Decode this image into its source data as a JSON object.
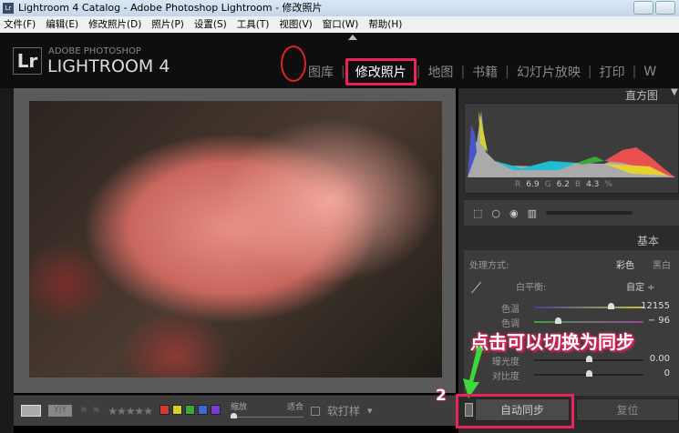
{
  "window": {
    "title": "Lightroom 4 Catalog - Adobe Photoshop Lightroom - 修改照片",
    "icon": "Lr"
  },
  "menu": [
    "文件(F)",
    "编辑(E)",
    "修改照片(D)",
    "照片(P)",
    "设置(S)",
    "工具(T)",
    "视图(V)",
    "窗口(W)",
    "帮助(H)"
  ],
  "logo": {
    "badge": "Lr",
    "sub": "ADOBE PHOTOSHOP",
    "main": "LIGHTROOM 4"
  },
  "modules": [
    {
      "label": "图库",
      "active": false
    },
    {
      "label": "修改照片",
      "active": true
    },
    {
      "label": "地图",
      "active": false
    },
    {
      "label": "书籍",
      "active": false
    },
    {
      "label": "幻灯片放映",
      "active": false
    },
    {
      "label": "打印",
      "active": false
    },
    {
      "label": "W",
      "active": false
    }
  ],
  "histogram": {
    "title": "直方图",
    "r_label": "R",
    "r": "6.9",
    "g_label": "G",
    "g": "6.2",
    "b_label": "B",
    "b": "4.3",
    "unit": "%"
  },
  "basic": {
    "title": "基本",
    "treatment_label": "处理方式:",
    "color": "彩色",
    "bw": "黑白",
    "wb_label": "白平衡:",
    "wb_value": "自定 ÷",
    "sliders": [
      {
        "label": "色温",
        "value": "12155",
        "pos": 0.72
      },
      {
        "label": "色调",
        "value": "− 96",
        "pos": 0.2
      },
      {
        "label": "曝光度",
        "value": "0.00",
        "pos": 0.5
      },
      {
        "label": "对比度",
        "value": "0",
        "pos": 0.5
      }
    ]
  },
  "toolbar": {
    "y_label": "Y|Y",
    "stars": "★★★★★",
    "colors": [
      "#d23a32",
      "#d8d020",
      "#3aaa3a",
      "#3a6ad8",
      "#7a3ad8"
    ],
    "zoom_label": "缩放",
    "fit_label": "适合",
    "softproof": "软打样"
  },
  "buttons": {
    "sync": "自动同步",
    "reset": "复位"
  },
  "annotation": {
    "text": "点击可以切换为同步",
    "step": "2",
    "accent": "#e8245c"
  }
}
